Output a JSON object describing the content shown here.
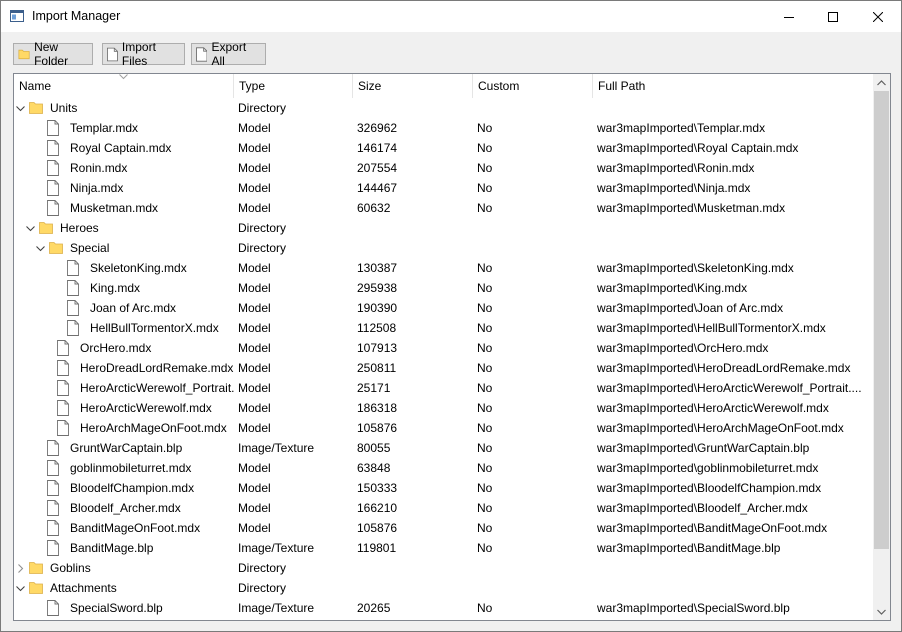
{
  "window": {
    "title": "Import Manager"
  },
  "toolbar": {
    "new_folder": "New Folder",
    "import_files": "Import Files",
    "export_all": "Export All"
  },
  "columns": [
    "Name",
    "Type",
    "Size",
    "Custom",
    "Full Path"
  ],
  "rows": [
    {
      "name": "Units",
      "type": "Directory",
      "size": "",
      "custom": "",
      "path": "",
      "level": 0,
      "kind": "folder",
      "expand": "open"
    },
    {
      "name": "Templar.mdx",
      "type": "Model",
      "size": "326962",
      "custom": "No",
      "path": "war3mapImported\\Templar.mdx",
      "level": 1,
      "kind": "file",
      "expand": "none"
    },
    {
      "name": "Royal Captain.mdx",
      "type": "Model",
      "size": "146174",
      "custom": "No",
      "path": "war3mapImported\\Royal Captain.mdx",
      "level": 1,
      "kind": "file",
      "expand": "none"
    },
    {
      "name": "Ronin.mdx",
      "type": "Model",
      "size": "207554",
      "custom": "No",
      "path": "war3mapImported\\Ronin.mdx",
      "level": 1,
      "kind": "file",
      "expand": "none"
    },
    {
      "name": "Ninja.mdx",
      "type": "Model",
      "size": "144467",
      "custom": "No",
      "path": "war3mapImported\\Ninja.mdx",
      "level": 1,
      "kind": "file",
      "expand": "none"
    },
    {
      "name": "Musketman.mdx",
      "type": "Model",
      "size": "60632",
      "custom": "No",
      "path": "war3mapImported\\Musketman.mdx",
      "level": 1,
      "kind": "file",
      "expand": "none"
    },
    {
      "name": "Heroes",
      "type": "Directory",
      "size": "",
      "custom": "",
      "path": "",
      "level": 1,
      "kind": "folder",
      "expand": "open"
    },
    {
      "name": "Special",
      "type": "Directory",
      "size": "",
      "custom": "",
      "path": "",
      "level": 2,
      "kind": "folder",
      "expand": "open"
    },
    {
      "name": "SkeletonKing.mdx",
      "type": "Model",
      "size": "130387",
      "custom": "No",
      "path": "war3mapImported\\SkeletonKing.mdx",
      "level": 3,
      "kind": "file",
      "expand": "none"
    },
    {
      "name": "King.mdx",
      "type": "Model",
      "size": "295938",
      "custom": "No",
      "path": "war3mapImported\\King.mdx",
      "level": 3,
      "kind": "file",
      "expand": "none"
    },
    {
      "name": "Joan of Arc.mdx",
      "type": "Model",
      "size": "190390",
      "custom": "No",
      "path": "war3mapImported\\Joan of Arc.mdx",
      "level": 3,
      "kind": "file",
      "expand": "none"
    },
    {
      "name": "HellBullTormentorX.mdx",
      "type": "Model",
      "size": "112508",
      "custom": "No",
      "path": "war3mapImported\\HellBullTormentorX.mdx",
      "level": 3,
      "kind": "file",
      "expand": "none"
    },
    {
      "name": "OrcHero.mdx",
      "type": "Model",
      "size": "107913",
      "custom": "No",
      "path": "war3mapImported\\OrcHero.mdx",
      "level": 2,
      "kind": "file",
      "expand": "none"
    },
    {
      "name": "HeroDreadLordRemake.mdx",
      "type": "Model",
      "size": "250811",
      "custom": "No",
      "path": "war3mapImported\\HeroDreadLordRemake.mdx",
      "level": 2,
      "kind": "file",
      "expand": "none"
    },
    {
      "name": "HeroArcticWerewolf_Portrait...",
      "type": "Model",
      "size": "25171",
      "custom": "No",
      "path": "war3mapImported\\HeroArcticWerewolf_Portrait....",
      "level": 2,
      "kind": "file",
      "expand": "none"
    },
    {
      "name": "HeroArcticWerewolf.mdx",
      "type": "Model",
      "size": "186318",
      "custom": "No",
      "path": "war3mapImported\\HeroArcticWerewolf.mdx",
      "level": 2,
      "kind": "file",
      "expand": "none"
    },
    {
      "name": "HeroArchMageOnFoot.mdx",
      "type": "Model",
      "size": "105876",
      "custom": "No",
      "path": "war3mapImported\\HeroArchMageOnFoot.mdx",
      "level": 2,
      "kind": "file",
      "expand": "none"
    },
    {
      "name": "GruntWarCaptain.blp",
      "type": "Image/Texture",
      "size": "80055",
      "custom": "No",
      "path": "war3mapImported\\GruntWarCaptain.blp",
      "level": 1,
      "kind": "file",
      "expand": "none"
    },
    {
      "name": "goblinmobileturret.mdx",
      "type": "Model",
      "size": "63848",
      "custom": "No",
      "path": "war3mapImported\\goblinmobileturret.mdx",
      "level": 1,
      "kind": "file",
      "expand": "none"
    },
    {
      "name": "BloodelfChampion.mdx",
      "type": "Model",
      "size": "150333",
      "custom": "No",
      "path": "war3mapImported\\BloodelfChampion.mdx",
      "level": 1,
      "kind": "file",
      "expand": "none"
    },
    {
      "name": "Bloodelf_Archer.mdx",
      "type": "Model",
      "size": "166210",
      "custom": "No",
      "path": "war3mapImported\\Bloodelf_Archer.mdx",
      "level": 1,
      "kind": "file",
      "expand": "none"
    },
    {
      "name": "BanditMageOnFoot.mdx",
      "type": "Model",
      "size": "105876",
      "custom": "No",
      "path": "war3mapImported\\BanditMageOnFoot.mdx",
      "level": 1,
      "kind": "file",
      "expand": "none"
    },
    {
      "name": "BanditMage.blp",
      "type": "Image/Texture",
      "size": "119801",
      "custom": "No",
      "path": "war3mapImported\\BanditMage.blp",
      "level": 1,
      "kind": "file",
      "expand": "none"
    },
    {
      "name": "Goblins",
      "type": "Directory",
      "size": "",
      "custom": "",
      "path": "",
      "level": 0,
      "kind": "folder",
      "expand": "closed"
    },
    {
      "name": "Attachments",
      "type": "Directory",
      "size": "",
      "custom": "",
      "path": "",
      "level": 0,
      "kind": "folder",
      "expand": "open"
    },
    {
      "name": "SpecialSword.blp",
      "type": "Image/Texture",
      "size": "20265",
      "custom": "No",
      "path": "war3mapImported\\SpecialSword.blp",
      "level": 1,
      "kind": "file",
      "expand": "none"
    }
  ]
}
